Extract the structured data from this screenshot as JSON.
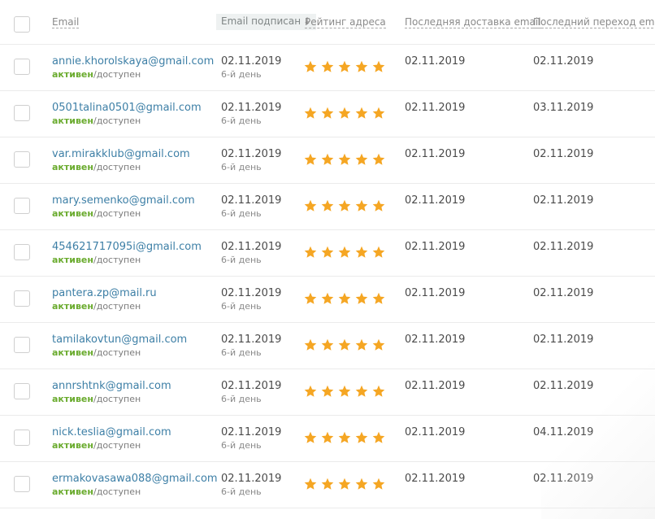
{
  "header": {
    "email": "Email",
    "subscribed": "Email подписан",
    "sort_icon": "↓",
    "rating": "Рейтинг адреса",
    "last_delivery": "Последняя доставка email",
    "last_click": "Последний переход email"
  },
  "status": {
    "active": "активен",
    "separator": "/",
    "available": "доступен"
  },
  "star_color": "#f5a623",
  "rows": [
    {
      "email": "annie.khorolskaya@gmail.com",
      "subscribed": "02.11.2019",
      "day": "6-й день",
      "rating": 5,
      "delivery": "02.11.2019",
      "click": "02.11.2019"
    },
    {
      "email": "0501talina0501@gmail.com",
      "subscribed": "02.11.2019",
      "day": "6-й день",
      "rating": 5,
      "delivery": "02.11.2019",
      "click": "03.11.2019"
    },
    {
      "email": "var.mirakklub@gmail.com",
      "subscribed": "02.11.2019",
      "day": "6-й день",
      "rating": 5,
      "delivery": "02.11.2019",
      "click": "02.11.2019"
    },
    {
      "email": "mary.semenko@gmail.com",
      "subscribed": "02.11.2019",
      "day": "6-й день",
      "rating": 5,
      "delivery": "02.11.2019",
      "click": "02.11.2019"
    },
    {
      "email": "454621717095i@gmail.com",
      "subscribed": "02.11.2019",
      "day": "6-й день",
      "rating": 5,
      "delivery": "02.11.2019",
      "click": "02.11.2019"
    },
    {
      "email": "pantera.zp@mail.ru",
      "subscribed": "02.11.2019",
      "day": "6-й день",
      "rating": 5,
      "delivery": "02.11.2019",
      "click": "02.11.2019"
    },
    {
      "email": "tamilakovtun@gmail.com",
      "subscribed": "02.11.2019",
      "day": "6-й день",
      "rating": 5,
      "delivery": "02.11.2019",
      "click": "02.11.2019"
    },
    {
      "email": "annrshtnk@gmail.com",
      "subscribed": "02.11.2019",
      "day": "6-й день",
      "rating": 5,
      "delivery": "02.11.2019",
      "click": "02.11.2019"
    },
    {
      "email": "nick.teslia@gmail.com",
      "subscribed": "02.11.2019",
      "day": "6-й день",
      "rating": 5,
      "delivery": "02.11.2019",
      "click": "04.11.2019"
    },
    {
      "email": "ermakovasawa088@gmail.com",
      "subscribed": "02.11.2019",
      "day": "6-й день",
      "rating": 5,
      "delivery": "02.11.2019",
      "click": "02.11.2019"
    }
  ]
}
